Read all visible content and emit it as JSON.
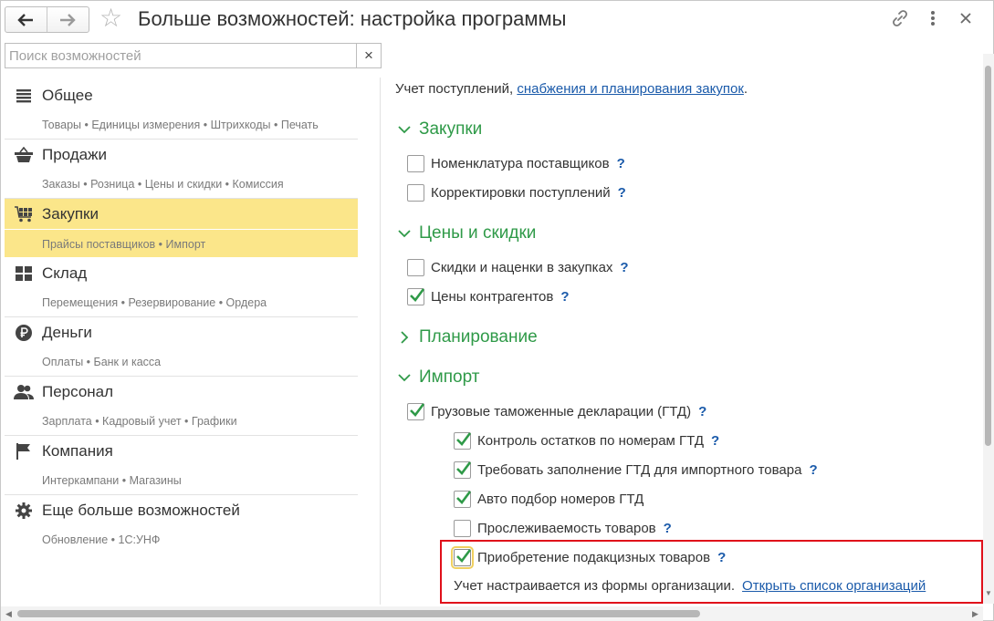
{
  "header": {
    "back_icon": "arrow-left-icon",
    "forward_icon": "arrow-right-icon",
    "title": "Больше возможностей: настройка программы"
  },
  "search": {
    "placeholder": "Поиск возможностей",
    "clear_symbol": "×"
  },
  "sidebar": {
    "sections": [
      {
        "title": "Общее",
        "subs": "Товары • Единицы измерения • Штрихкоды • Печать",
        "icon": "list-icon"
      },
      {
        "title": "Продажи",
        "subs": "Заказы • Розница • Цены и скидки • Комиссия",
        "icon": "basket-icon"
      },
      {
        "title": "Закупки",
        "subs": "Прайсы поставщиков • Импорт",
        "icon": "cart-icon",
        "active": true
      },
      {
        "title": "Склад",
        "subs": "Перемещения • Резервирование • Ордера",
        "icon": "warehouse-icon"
      },
      {
        "title": "Деньги",
        "subs": "Оплаты • Банк и касса",
        "icon": "ruble-icon"
      },
      {
        "title": "Персонал",
        "subs": "Зарплата • Кадровый учет • Графики",
        "icon": "people-icon"
      },
      {
        "title": "Компания",
        "subs": "Интеркампани • Магазины",
        "icon": "flag-icon"
      },
      {
        "title": "Еще больше возможностей",
        "subs": "Обновление • 1С:УНФ",
        "icon": "gear-icon"
      }
    ]
  },
  "main": {
    "intro_text": "Учет поступлений, ",
    "intro_link": "снабжения и планирования закупок",
    "intro_end": ".",
    "help_symbol": "?",
    "groups": {
      "zakupki": "Закупки",
      "ceny": "Цены и скидки",
      "planirovanie": "Планирование",
      "import": "Импорт"
    },
    "options": {
      "nomenklatura": {
        "label": "Номенклатура поставщиков",
        "checked": false
      },
      "korrektirovki": {
        "label": "Корректировки поступлений",
        "checked": false
      },
      "skidki": {
        "label": "Скидки и наценки в закупках",
        "checked": false
      },
      "ceny_kontragentov": {
        "label": "Цены контрагентов",
        "checked": true
      },
      "gtd": {
        "label": "Грузовые таможенные декларации (ГТД)",
        "checked": true
      },
      "kontrol": {
        "label": "Контроль остатков по номерам ГТД",
        "checked": true
      },
      "trebovat": {
        "label": "Требовать заполнение ГТД для импортного товара",
        "checked": true
      },
      "avto": {
        "label": "Авто подбор номеров ГТД",
        "checked": true
      },
      "proslezh": {
        "label": "Прослеживаемость товаров",
        "checked": false
      },
      "akciz": {
        "label": "Приобретение подакцизных товаров",
        "checked": true
      }
    },
    "note_text": "Учет настраивается из формы организации.",
    "note_link": "Открыть список организаций"
  },
  "colors": {
    "accent_green": "#2f9a48",
    "link_blue": "#1a5aaa",
    "active_yellow": "#fbe68a",
    "highlight_red": "#e0101a"
  }
}
